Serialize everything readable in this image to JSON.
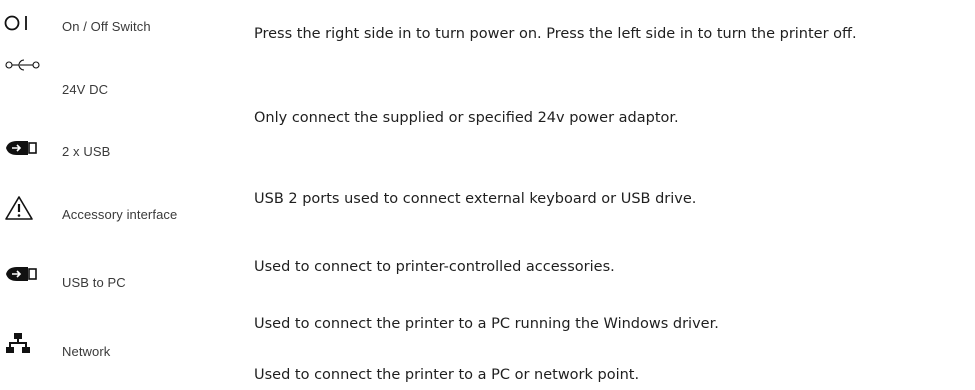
{
  "legend": {
    "rows": [
      {
        "icon": "on-off-switch-icon",
        "label": "On / Off Switch"
      },
      {
        "icon": "dc-power-icon",
        "label": "24V DC"
      },
      {
        "icon": "usb-plug-icon",
        "label": "2 x USB"
      },
      {
        "icon": "warning-triangle-icon",
        "label": "Accessory interface"
      },
      {
        "icon": "usb-plug-icon",
        "label": "USB to PC"
      },
      {
        "icon": "network-icon",
        "label": "Network"
      }
    ],
    "descriptions": [
      "Press the right side in to turn power on. Press the left side in to turn the printer off.",
      "Only connect the supplied or specified 24v power adaptor.",
      "USB 2 ports used to connect external keyboard or USB drive.",
      "Used to connect to printer-controlled accessories.",
      "Used to connect the printer to a PC running the Windows driver.",
      "Used to connect the printer to a PC or network point."
    ]
  }
}
